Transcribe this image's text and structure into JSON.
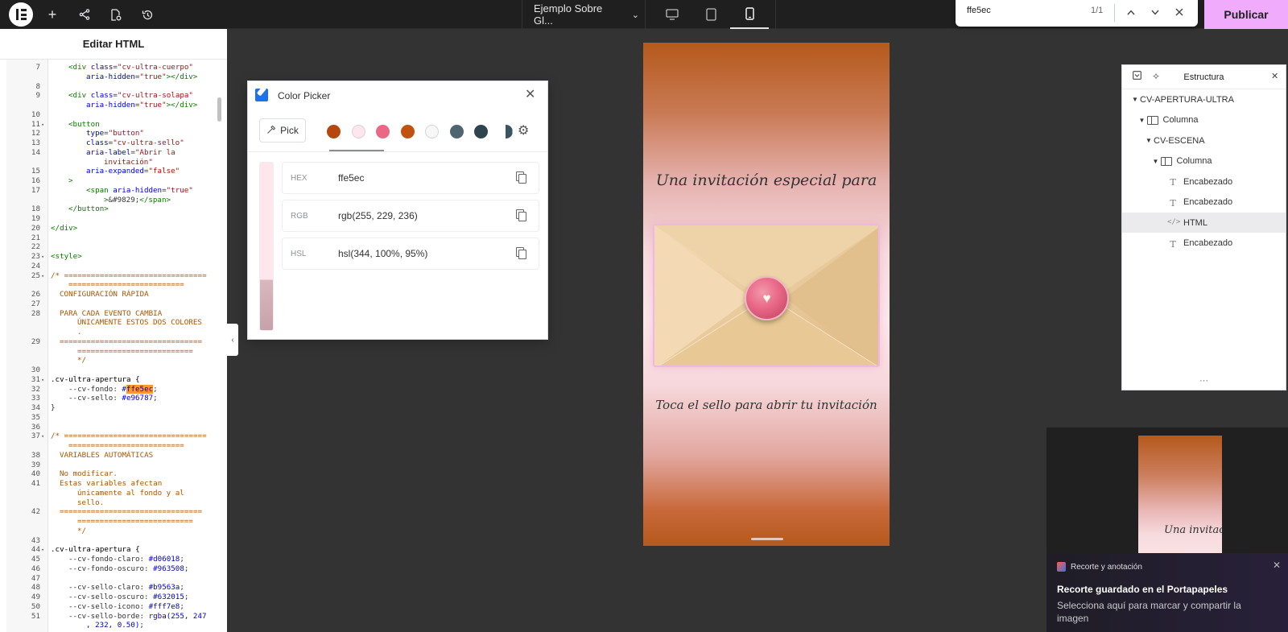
{
  "toolbar": {
    "add_icon": "plus-icon",
    "document_title": "Ejemplo Sobre Gl...",
    "publish_label": "Publicar"
  },
  "findbar": {
    "query": "ffe5ec",
    "count": "1/1"
  },
  "left_panel": {
    "title": "Editar HTML",
    "code_lines": [
      {
        "n": "7",
        "html": "<span class='tag'>&lt;div</span> <span class='attr'>class</span>=<span class='str'>\"cv-ultra-cuerpo\"</span>",
        "indent": 2
      },
      {
        "n": "",
        "html": "<span class='attr'>aria-hidden</span>=<span class='str'>\"true\"</span><span class='tag'>&gt;&lt;/div&gt;</span>",
        "indent": 4
      },
      {
        "n": "8",
        "html": ""
      },
      {
        "n": "9",
        "html": "<span class='tag'>&lt;div</span> <span class='attr'>class</span>=<span class='str'>\"cv-ultra-solapa\"</span>",
        "indent": 2
      },
      {
        "n": "",
        "html": "<span class='attr'>aria-hidden</span>=<span class='str'>\"true\"</span><span class='tag'>&gt;&lt;/div&gt;</span>",
        "indent": 4
      },
      {
        "n": "10",
        "html": ""
      },
      {
        "n": "11",
        "fold": true,
        "html": "<span class='tag'>&lt;button</span>",
        "indent": 2
      },
      {
        "n": "12",
        "html": "<span class='attr'>type</span>=<span class='str'>\"button\"</span>",
        "indent": 4
      },
      {
        "n": "13",
        "html": "<span class='attr'>class</span>=<span class='str'>\"cv-ultra-sello\"</span>",
        "indent": 4
      },
      {
        "n": "14",
        "html": "<span class='attr'>aria-label</span>=<span class='str'>\"Abrir la</span>",
        "indent": 4
      },
      {
        "n": "",
        "html": "<span class='str'>invitación\"</span>",
        "indent": 6
      },
      {
        "n": "15",
        "html": "<span class='attr'>aria-expanded</span>=<span class='str'>\"false\"</span>",
        "indent": 4
      },
      {
        "n": "16",
        "html": "<span class='tag'>&gt;</span>",
        "indent": 2
      },
      {
        "n": "17",
        "html": "<span class='tag'>&lt;span</span> <span class='attr'>aria-hidden</span>=<span class='str'>\"true\"</span>",
        "indent": 4
      },
      {
        "n": "",
        "html": "<span class='tag'>&gt;</span>&amp;#9829;<span class='tag'>&lt;/span&gt;</span>",
        "indent": 6
      },
      {
        "n": "18",
        "html": "<span class='tag'>&lt;/button&gt;</span>",
        "indent": 2
      },
      {
        "n": "19",
        "html": ""
      },
      {
        "n": "20",
        "html": "<span class='tag'>&lt;/div&gt;</span>",
        "indent": 0
      },
      {
        "n": "21",
        "html": ""
      },
      {
        "n": "22",
        "html": ""
      },
      {
        "n": "23",
        "fold": true,
        "html": "<span class='tag'>&lt;style&gt;</span>",
        "indent": 0
      },
      {
        "n": "24",
        "html": ""
      },
      {
        "n": "25",
        "fold": true,
        "html": "<span class='cm'>/* ================================</span>",
        "indent": 0
      },
      {
        "n": "",
        "html": "<span class='cm'>==========================</span>",
        "indent": 2
      },
      {
        "n": "26",
        "html": "<span class='cm'>CONFIGURACIÓN RÁPIDA</span>",
        "indent": 1
      },
      {
        "n": "27",
        "html": ""
      },
      {
        "n": "28",
        "html": "<span class='cm'>PARA CADA EVENTO CAMBIA</span>",
        "indent": 1
      },
      {
        "n": "",
        "html": "<span class='cm'>ÚNICAMENTE ESTOS DOS COLORES</span>",
        "indent": 3
      },
      {
        "n": "",
        "html": "<span class='cm'>.</span>",
        "indent": 3
      },
      {
        "n": "29",
        "html": "<span class='cm'>================================</span>",
        "indent": 1
      },
      {
        "n": "",
        "html": "<span class='cm'>==========================</span>",
        "indent": 3
      },
      {
        "n": "",
        "html": "<span class='cm'>*/</span>",
        "indent": 3
      },
      {
        "n": "30",
        "html": ""
      },
      {
        "n": "31",
        "fold": true,
        "html": "<span class='sel'>.cv-ultra-apertura {</span>",
        "indent": 0
      },
      {
        "n": "32",
        "html": "<span class='prop'>--cv-fondo:</span> <span class='val'>#<span class='hl'>ffe5ec</span></span>;",
        "indent": 2
      },
      {
        "n": "33",
        "html": "<span class='prop'>--cv-sello:</span> <span class='val'>#e96787</span>;",
        "indent": 2
      },
      {
        "n": "34",
        "html": "}",
        "indent": 0
      },
      {
        "n": "35",
        "html": ""
      },
      {
        "n": "36",
        "html": ""
      },
      {
        "n": "37",
        "fold": true,
        "html": "<span class='cm'>/* ================================</span>",
        "indent": 0
      },
      {
        "n": "",
        "html": "<span class='cm'>==========================</span>",
        "indent": 2
      },
      {
        "n": "38",
        "html": "<span class='cm'>VARIABLES AUTOMÁTICAS</span>",
        "indent": 1
      },
      {
        "n": "39",
        "html": ""
      },
      {
        "n": "40",
        "html": "<span class='cm'>No modificar.</span>",
        "indent": 1
      },
      {
        "n": "41",
        "html": "<span class='cm'>Estas variables afectan</span>",
        "indent": 1
      },
      {
        "n": "",
        "html": "<span class='cm'>únicamente al fondo y al</span>",
        "indent": 3
      },
      {
        "n": "",
        "html": "<span class='cm'>sello.</span>",
        "indent": 3
      },
      {
        "n": "42",
        "html": "<span class='cm'>================================</span>",
        "indent": 1
      },
      {
        "n": "",
        "html": "<span class='cm'>==========================</span>",
        "indent": 3
      },
      {
        "n": "",
        "html": "<span class='cm'>*/</span>",
        "indent": 3
      },
      {
        "n": "43",
        "html": ""
      },
      {
        "n": "44",
        "fold": true,
        "html": "<span class='sel'>.cv-ultra-apertura {</span>",
        "indent": 0
      },
      {
        "n": "45",
        "html": "<span class='prop'>--cv-fondo-claro:</span> <span class='val'>#d06018</span>;",
        "indent": 2
      },
      {
        "n": "46",
        "html": "<span class='prop'>--cv-fondo-oscuro:</span> <span class='val'>#963508</span>;",
        "indent": 2
      },
      {
        "n": "47",
        "html": ""
      },
      {
        "n": "48",
        "html": "<span class='prop'>--cv-sello-claro:</span> <span class='val'>#b9563a</span>;",
        "indent": 2
      },
      {
        "n": "49",
        "html": "<span class='prop'>--cv-sello-oscuro:</span> <span class='val'>#632015</span>;",
        "indent": 2
      },
      {
        "n": "50",
        "html": "<span class='prop'>--cv-sello-icono:</span> <span class='val'>#fff7e8</span>;",
        "indent": 2
      },
      {
        "n": "51",
        "html": "<span class='prop'>--cv-sello-borde:</span> <span class='val'>rgba(255, 247</span>",
        "indent": 2
      },
      {
        "n": "",
        "html": "<span class='val'>, 232, 0.50)</span>;",
        "indent": 4
      }
    ]
  },
  "color_picker": {
    "title": "Color Picker",
    "pick_label": "Pick",
    "swatches": [
      "#b5480f",
      "#ffe5ec",
      "#e96787",
      "#c0510f",
      "#f7f7f7",
      "#4f6570",
      "#2e4550",
      "#3b5560"
    ],
    "rows": [
      {
        "label": "HEX",
        "value": "ffe5ec"
      },
      {
        "label": "RGB",
        "value": "rgb(255, 229, 236)"
      },
      {
        "label": "HSL",
        "value": "hsl(344, 100%, 95%)"
      }
    ]
  },
  "preview": {
    "heading": "Una invitación especial para",
    "seal_glyph": "♥",
    "subheading": "Toca el sello para abrir tu invitación"
  },
  "structure": {
    "title": "Estructura",
    "items": [
      {
        "label": "CV-APERTURA-ULTRA",
        "level": 0,
        "caret": true,
        "icon": ""
      },
      {
        "label": "Columna",
        "level": 1,
        "caret": true,
        "icon": "col"
      },
      {
        "label": "CV-ESCENA",
        "level": 2,
        "caret": true,
        "icon": ""
      },
      {
        "label": "Columna",
        "level": 3,
        "caret": true,
        "icon": "col"
      },
      {
        "label": "Encabezado",
        "level": 4,
        "caret": false,
        "icon": "t"
      },
      {
        "label": "Encabezado",
        "level": 4,
        "caret": false,
        "icon": "t"
      },
      {
        "label": "HTML",
        "level": 4,
        "caret": false,
        "icon": "html",
        "selected": true
      },
      {
        "label": "Encabezado",
        "level": 4,
        "caret": false,
        "icon": "t"
      }
    ]
  },
  "mini_preview": {
    "text": "Una invitaci"
  },
  "toast": {
    "app": "Recorte y anotación",
    "title": "Recorte guardado en el Portapapeles",
    "body": "Selecciona aquí para marcar y compartir la imagen"
  }
}
